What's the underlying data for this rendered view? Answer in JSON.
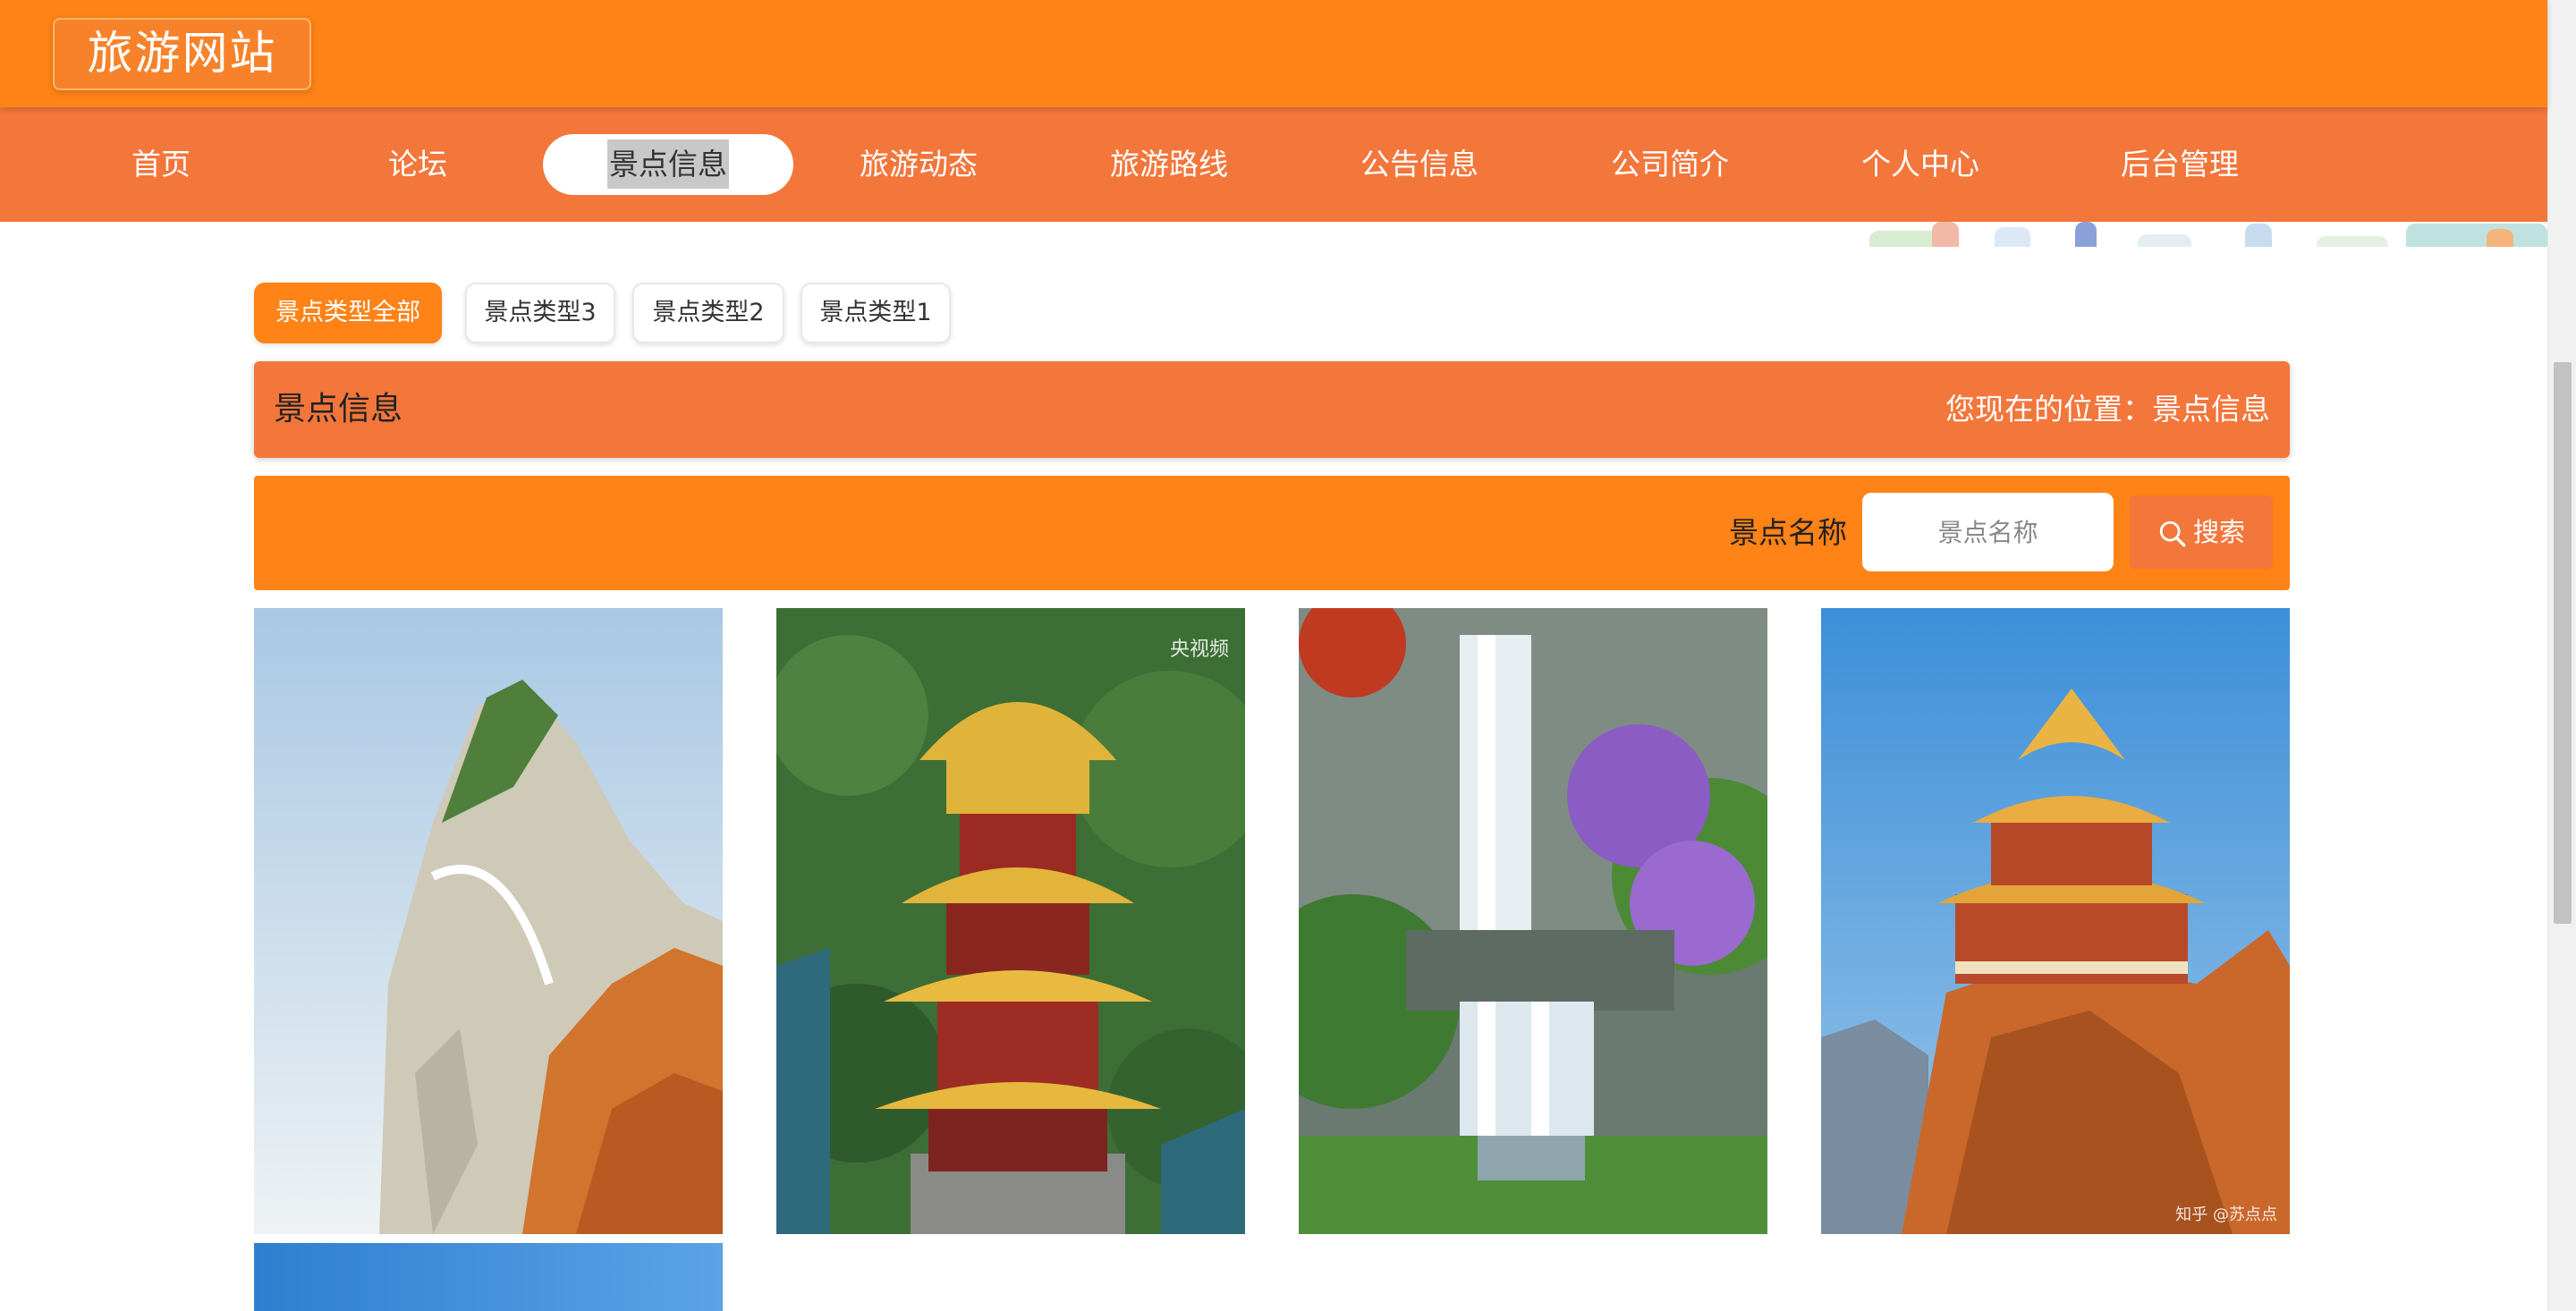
{
  "header": {
    "logo_text": "旅游网站",
    "brand_color": "#ff8316"
  },
  "nav": {
    "items": [
      {
        "label": "首页",
        "active": false
      },
      {
        "label": "论坛",
        "active": false
      },
      {
        "label": "景点信息",
        "active": true
      },
      {
        "label": "旅游动态",
        "active": false
      },
      {
        "label": "旅游路线",
        "active": false
      },
      {
        "label": "公告信息",
        "active": false
      },
      {
        "label": "公司简介",
        "active": false
      },
      {
        "label": "个人中心",
        "active": false
      },
      {
        "label": "后台管理",
        "active": false
      }
    ],
    "bar_color": "#f3763b"
  },
  "categories": [
    {
      "label": "景点类型全部",
      "active": true
    },
    {
      "label": "景点类型3",
      "active": false
    },
    {
      "label": "景点类型2",
      "active": false
    },
    {
      "label": "景点类型1",
      "active": false
    }
  ],
  "title_bar": {
    "title": "景点信息",
    "breadcrumb": "您现在的位置：景点信息"
  },
  "search": {
    "label": "景点名称",
    "placeholder": "景点名称",
    "value": "",
    "button_label": "搜索",
    "button_icon": "search-icon"
  },
  "cards": [
    {
      "image": "mountain-cliff-walkway-photo",
      "watermark": ""
    },
    {
      "image": "yellow-crane-pagoda-photo",
      "watermark": "央视频"
    },
    {
      "image": "waterfall-photo",
      "watermark": ""
    },
    {
      "image": "cliff-temple-photo",
      "watermark": "知乎 @苏点点"
    },
    {
      "image": "blue-sky-photo",
      "watermark": ""
    }
  ]
}
